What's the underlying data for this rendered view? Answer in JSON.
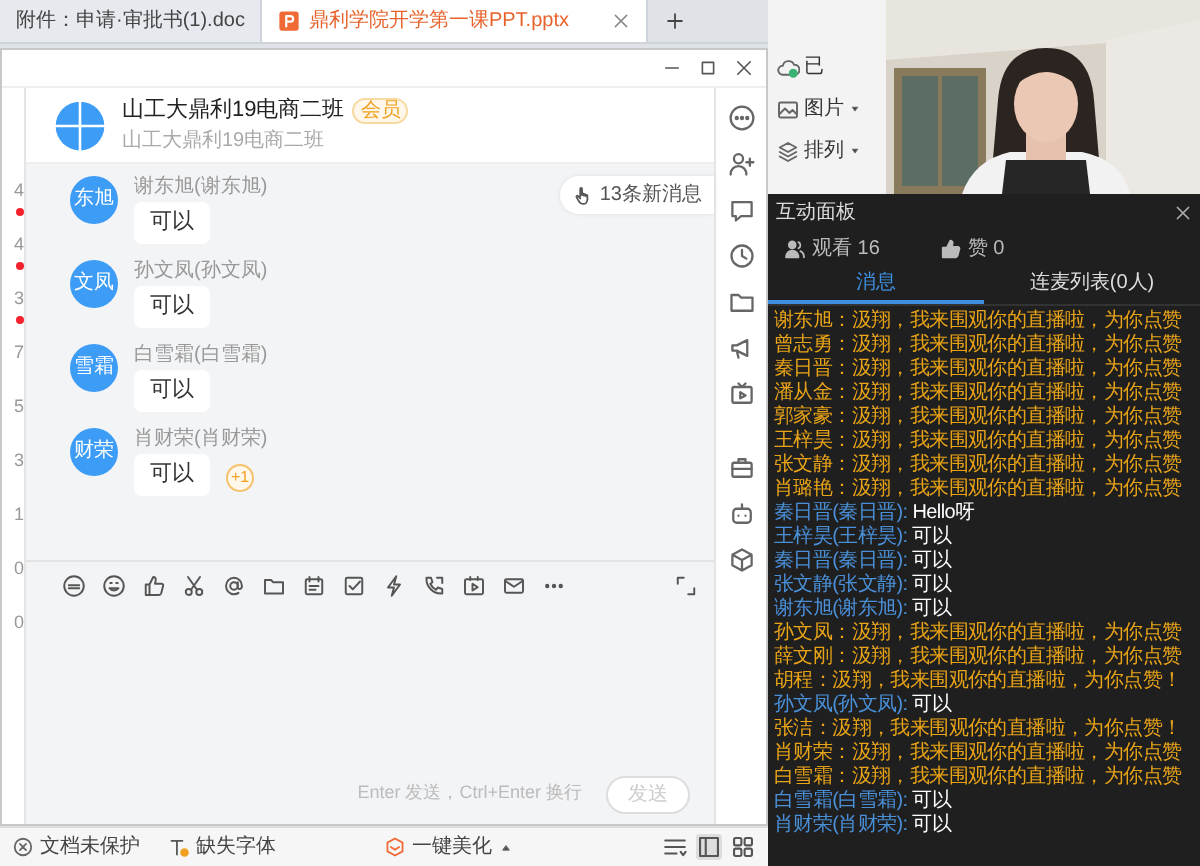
{
  "doc_tabs": [
    {
      "label": "附件：申请·审批书(1).doc",
      "selected": false,
      "kind": "doc"
    },
    {
      "label": "鼎利学院开学第一课PPT.pptx",
      "selected": true,
      "kind": "ppt"
    }
  ],
  "ribbon": {
    "sync_status": "已",
    "items": [
      "图片",
      "排列"
    ]
  },
  "chat": {
    "group_name": "山工大鼎利19电商二班",
    "badge": "会员",
    "subtitle": "山工大鼎利19电商二班",
    "edge_items": [
      {
        "text": "4",
        "unread": true
      },
      {
        "text": "4",
        "unread": true
      },
      {
        "text": "3",
        "unread": true
      },
      {
        "text": "7",
        "unread": false
      },
      {
        "text": "5",
        "unread": false
      },
      {
        "text": "3",
        "unread": false
      },
      {
        "text": "1",
        "unread": false
      },
      {
        "text": "0",
        "unread": false
      },
      {
        "text": "0",
        "unread": false
      }
    ],
    "new_messages": "13条新消息",
    "messages": [
      {
        "avatar": "东旭",
        "sender": "谢东旭(谢东旭)",
        "text": "可以"
      },
      {
        "avatar": "文凤",
        "sender": "孙文凤(孙文凤)",
        "text": "可以"
      },
      {
        "avatar": "雪霜",
        "sender": "白雪霜(白雪霜)",
        "text": "可以"
      },
      {
        "avatar": "财荣",
        "sender": "肖财荣(肖财荣)",
        "text": "可以",
        "plus_one": "+1"
      }
    ],
    "input_hint": "Enter 发送，Ctrl+Enter 换行",
    "send_button": {
      "label": "发送",
      "disabled": true
    }
  },
  "status_bar": {
    "protection": "文档未保护",
    "missing_fonts": "缺失字体",
    "beautify": "一键美化"
  },
  "panel": {
    "title": "互动面板",
    "viewers": "观看 16",
    "likes": "赞 0",
    "tabs": [
      {
        "label": "消息",
        "selected": true
      },
      {
        "label": "连麦列表(0人)",
        "selected": false
      }
    ],
    "messages": [
      {
        "kind": "like",
        "name": "谢东旭：",
        "text": "汲翔，我来围观你的直播啦，为你点赞"
      },
      {
        "kind": "like",
        "name": "曾志勇：",
        "text": "汲翔，我来围观你的直播啦，为你点赞"
      },
      {
        "kind": "like",
        "name": "秦日晋：",
        "text": "汲翔，我来围观你的直播啦，为你点赞"
      },
      {
        "kind": "like",
        "name": "潘从金：",
        "text": "汲翔，我来围观你的直播啦，为你点赞"
      },
      {
        "kind": "like",
        "name": "郭家豪：",
        "text": "汲翔，我来围观你的直播啦，为你点赞"
      },
      {
        "kind": "like",
        "name": "王梓昊：",
        "text": "汲翔，我来围观你的直播啦，为你点赞"
      },
      {
        "kind": "like",
        "name": "张文静：",
        "text": "汲翔，我来围观你的直播啦，为你点赞"
      },
      {
        "kind": "like",
        "name": "肖璐艳：",
        "text": "汲翔，我来围观你的直播啦，为你点赞"
      },
      {
        "kind": "chat",
        "name": "秦日晋(秦日晋):",
        "text": "Hello呀"
      },
      {
        "kind": "chat",
        "name": "王梓昊(王梓昊):",
        "text": "可以"
      },
      {
        "kind": "chat",
        "name": "秦日晋(秦日晋):",
        "text": "可以"
      },
      {
        "kind": "chat",
        "name": "张文静(张文静):",
        "text": "可以"
      },
      {
        "kind": "chat",
        "name": "谢东旭(谢东旭):",
        "text": "可以"
      },
      {
        "kind": "like",
        "name": "孙文凤：",
        "text": "汲翔，我来围观你的直播啦，为你点赞"
      },
      {
        "kind": "like",
        "name": "薛文刚：",
        "text": "汲翔，我来围观你的直播啦，为你点赞"
      },
      {
        "kind": "like",
        "name": "胡程：",
        "text": "汲翔，我来围观你的直播啦，为你点赞！"
      },
      {
        "kind": "chat",
        "name": "孙文凤(孙文凤):",
        "text": "可以"
      },
      {
        "kind": "like",
        "name": "张洁：",
        "text": "汲翔，我来围观你的直播啦，为你点赞！"
      },
      {
        "kind": "like",
        "name": "肖财荣：",
        "text": "汲翔，我来围观你的直播啦，为你点赞"
      },
      {
        "kind": "like",
        "name": "白雪霜：",
        "text": "汲翔，我来围观你的直播啦，为你点赞"
      },
      {
        "kind": "chat",
        "name": "白雪霜(白雪霜):",
        "text": "可以"
      },
      {
        "kind": "chat",
        "name": "肖财荣(肖财荣):",
        "text": "可以"
      }
    ]
  }
}
